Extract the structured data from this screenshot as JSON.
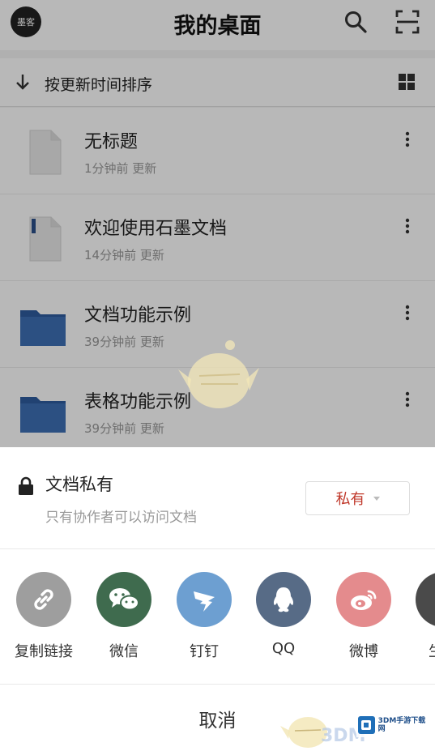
{
  "header": {
    "avatar_text": "墨客",
    "title": "我的桌面",
    "search_icon": "search-icon",
    "scan_icon": "scan-icon"
  },
  "sortbar": {
    "label": "按更新时间排序",
    "arrow_icon": "arrow-down-icon",
    "view_icon": "grid-view-icon"
  },
  "files": [
    {
      "name": "无标题",
      "meta": "1分钟前 更新",
      "type": "doc"
    },
    {
      "name": "欢迎使用石墨文档",
      "meta": "14分钟前 更新",
      "type": "doc"
    },
    {
      "name": "文档功能示例",
      "meta": "39分钟前 更新",
      "type": "folder"
    },
    {
      "name": "表格功能示例",
      "meta": "39分钟前 更新",
      "type": "folder"
    }
  ],
  "permission": {
    "title": "文档私有",
    "description": "只有协作者可以访问文档",
    "select_value": "私有"
  },
  "share": [
    {
      "label": "复制链接",
      "icon": "link-icon",
      "color": "#9e9e9e"
    },
    {
      "label": "微信",
      "icon": "wechat-icon",
      "color": "#3f6b4e"
    },
    {
      "label": "钉钉",
      "icon": "dingtalk-icon",
      "color": "#6d9fd1"
    },
    {
      "label": "QQ",
      "icon": "qq-icon",
      "color": "#576b86"
    },
    {
      "label": "微博",
      "icon": "weibo-icon",
      "color": "#e48b8d"
    },
    {
      "label": "生成",
      "icon": "generate-icon",
      "color": "#4a4a4a"
    }
  ],
  "cancel_label": "取消",
  "watermark": {
    "brand": "3DM",
    "logo_text": "3DM手游下载网"
  },
  "colors": {
    "accent": "#c0392b",
    "folder": "#3d6fb4",
    "overlay": "rgba(0,0,0,0.28)"
  }
}
